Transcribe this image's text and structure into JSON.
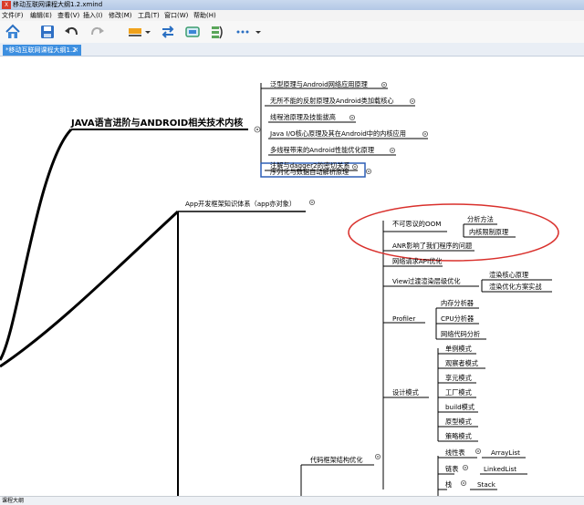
{
  "window": {
    "title": "移动互联网课程大纲1.2.xmind",
    "app_icon": "X"
  },
  "menu": [
    "文件(F)",
    "编辑(E)",
    "查看(V)",
    "插入(I)",
    "修改(M)",
    "工具(T)",
    "窗口(W)",
    "帮助(H)"
  ],
  "toolbar": {
    "icons": [
      "home-icon",
      "save-icon",
      "undo-icon",
      "redo-icon",
      "topic-style-icon",
      "dropdown-icon",
      "relationship-icon",
      "boundary-icon",
      "summary-icon",
      "more-icon",
      "dropdown-icon"
    ]
  },
  "tab": {
    "label": "*移动互联网课程大纲1.2",
    "close": "✕"
  },
  "mindmap": {
    "branch_java": {
      "title": "JAVA语言进阶与ANDROID相关技术内核",
      "items": [
        "泛型原理与Android网络应用原理",
        "无所不能的反射原理及Android类加载核心",
        "线程池原理及技能拔高",
        "Java I/O核心原理及其在Android中的内核应用",
        "多线程带来的Android性能优化原理",
        "注解与dagger2的密切关系",
        "序列化与数据自动解析原理"
      ]
    },
    "branch_app": {
      "title": "App开发框架知识体系（app亦对象）",
      "oom": {
        "title": "不可思议的OOM",
        "children": [
          "分析方法",
          "内核限制原理"
        ]
      },
      "anr": "ANR影响了我们程序的问题",
      "net": "网络请求API优化",
      "view": {
        "title": "View过渡渲染层级优化",
        "children": [
          "渲染核心原理",
          "渲染优化方案实战"
        ]
      },
      "profiler": {
        "title": "Profiler",
        "children": [
          "内存分析器",
          "CPU分析器",
          "网络代码分析"
        ]
      },
      "design": {
        "title": "设计模式",
        "children": [
          "单例模式",
          "观察者模式",
          "享元模式",
          "工厂模式",
          "build模式",
          "原型模式",
          "策略模式"
        ]
      },
      "framework": {
        "title": "代码框架结构优化",
        "children": [
          {
            "label": "线性表",
            "child": "ArrayList"
          },
          {
            "label": "链表",
            "child": "LinkedList"
          },
          {
            "label": "栈",
            "child": "Stack"
          }
        ]
      }
    }
  },
  "sheet_tab": "课程大纲",
  "colors": {
    "annotation": "#d9302c",
    "selected": "#2d5fb6",
    "line": "#000000",
    "tab": "#3d8fe0"
  }
}
